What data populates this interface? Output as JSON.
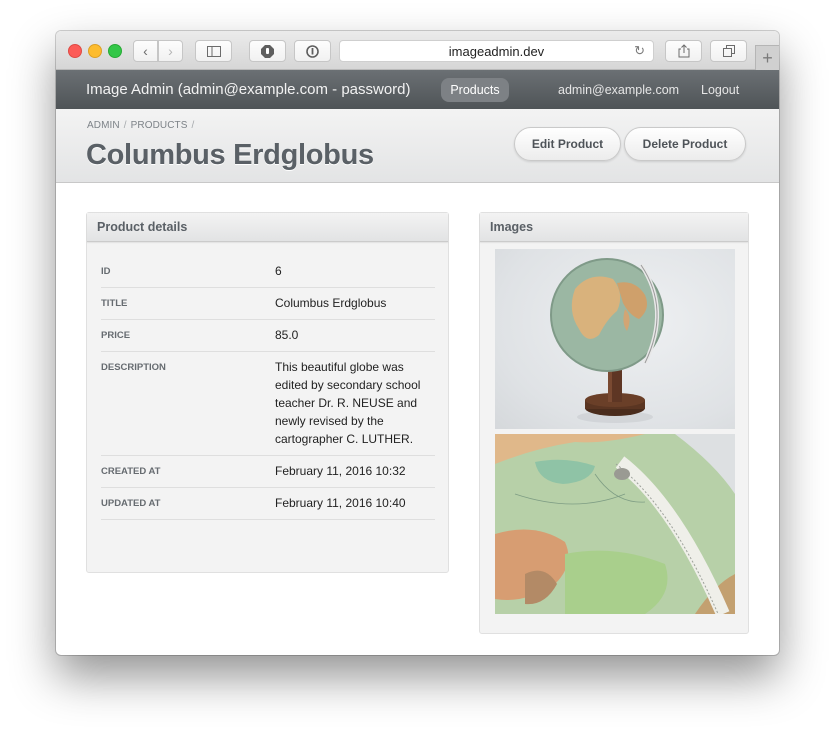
{
  "browser": {
    "url": "imageadmin.dev",
    "icons": {
      "back": "chevron-left-icon",
      "forward": "chevron-right-icon",
      "sidebar": "sidebar-icon",
      "extension1": "hand-stop-icon",
      "extension2": "password-manager-icon",
      "reload": "reload-icon",
      "share": "share-icon",
      "tabs": "tabs-overview-icon",
      "new_tab": "plus-icon"
    }
  },
  "nav": {
    "brand": "Image Admin (admin@example.com - password)",
    "products": "Products",
    "user": "admin@example.com",
    "logout": "Logout"
  },
  "header": {
    "breadcrumb": [
      "ADMIN",
      "PRODUCTS"
    ],
    "title": "Columbus Erdglobus",
    "edit_label": "Edit Product",
    "delete_label": "Delete Product"
  },
  "details": {
    "heading": "Product details",
    "rows": [
      {
        "label": "ID",
        "value": "6"
      },
      {
        "label": "TITLE",
        "value": "Columbus Erdglobus"
      },
      {
        "label": "PRICE",
        "value": "85.0"
      },
      {
        "label": "DESCRIPTION",
        "value": "This beautiful globe was edited by secondary school teacher Dr. R. NEUSE and newly revised by the cartographer C. LUTHER."
      },
      {
        "label": "CREATED AT",
        "value": "February 11, 2016 10:32"
      },
      {
        "label": "UPDATED AT",
        "value": "February 11, 2016 10:40"
      }
    ]
  },
  "images": {
    "heading": "Images",
    "items": [
      {
        "alt": "Globe on wooden stand"
      },
      {
        "alt": "Close-up of globe surface with meridian"
      }
    ]
  }
}
